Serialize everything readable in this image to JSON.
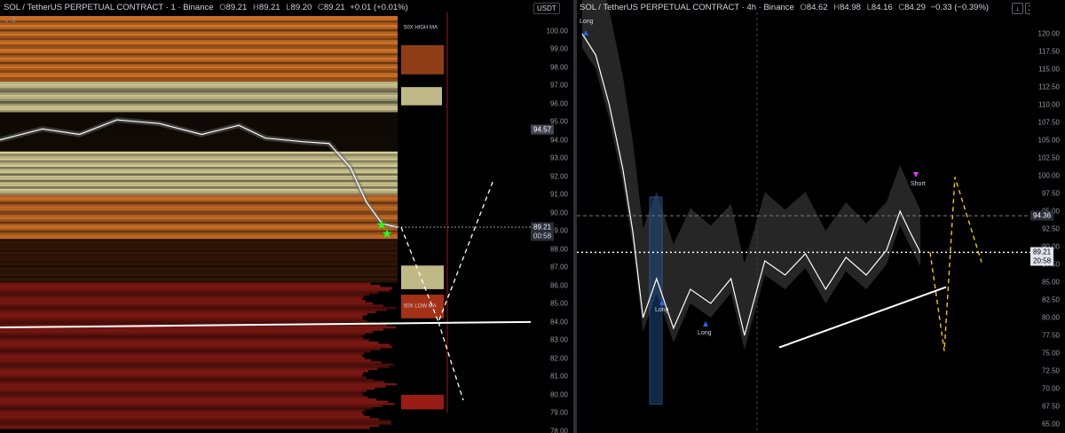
{
  "colors": {
    "background": "#000000",
    "heat_yellow": "#f0e6a8",
    "heat_orange": "#e07a2a",
    "heat_red": "#8a1a14",
    "ma_white": "#ffffff",
    "arrow_yellow": "#f5c518",
    "signal_blue": "#2962ff",
    "signal_pink": "#e040fb",
    "star_green": "#22ff22"
  },
  "left_chart": {
    "header": {
      "symbol": "SOL / TetherUS PERPETUAL CONTRACT · 1 · Binance",
      "o_label": "O",
      "o_value": "89.21",
      "h_label": "H",
      "h_value": "89.21",
      "l_label": "L",
      "l_value": "89.20",
      "c_label": "C",
      "c_value": "89.21",
      "change": "+0.01 (+0.01%)"
    },
    "indicator_count": "3",
    "currency": "USDT",
    "current_price": "89.21",
    "countdown": "00:58",
    "price_label_2": "94.57",
    "annotations": {
      "high_ma": "50X HIGH MA",
      "low_ma": "50X LOW MA"
    }
  },
  "right_chart": {
    "header": {
      "symbol": "SOL / TetherUS PERPETUAL CONTRACT · 4h · Binance",
      "o_label": "O",
      "o_value": "84.62",
      "h_label": "H",
      "h_value": "84.98",
      "l_label": "L",
      "l_value": "84.16",
      "c_label": "C",
      "c_value": "84.29",
      "change": "−0.33 (−0.39%)"
    },
    "current_price": "89.21",
    "countdown": "20:58",
    "alert_price": "94.36",
    "labels": {
      "long1": "Long",
      "long2": "Long",
      "long3": "Long",
      "short": "Short"
    }
  },
  "chart_data": [
    {
      "type": "heatmap",
      "title": "SOL / TetherUS PERPETUAL CONTRACT · 1 · Binance",
      "ylim": [
        78,
        101
      ],
      "y_ticks": [
        78,
        79,
        80,
        81,
        82,
        83,
        84,
        85,
        86,
        87,
        88,
        89,
        90,
        91,
        92,
        93,
        94,
        95,
        96,
        97,
        98,
        99,
        100
      ],
      "price_path": [
        {
          "t": 0,
          "y": 94.0
        },
        {
          "t": 0.08,
          "y": 94.6
        },
        {
          "t": 0.15,
          "y": 94.3
        },
        {
          "t": 0.22,
          "y": 95.1
        },
        {
          "t": 0.3,
          "y": 94.9
        },
        {
          "t": 0.38,
          "y": 94.3
        },
        {
          "t": 0.45,
          "y": 94.8
        },
        {
          "t": 0.5,
          "y": 94.1
        },
        {
          "t": 0.57,
          "y": 93.9
        },
        {
          "t": 0.62,
          "y": 93.8
        },
        {
          "t": 0.66,
          "y": 92.5
        },
        {
          "t": 0.69,
          "y": 90.6
        },
        {
          "t": 0.72,
          "y": 89.4
        },
        {
          "t": 0.75,
          "y": 89.2
        }
      ],
      "support_line": {
        "start": 83.7,
        "end": 84.0
      },
      "projection": [
        89.2,
        84.0,
        91.8,
        79.7
      ],
      "current_price": 89.21
    },
    {
      "type": "line",
      "title": "SOL / TetherUS PERPETUAL CONTRACT · 4h · Binance",
      "ylim": [
        64,
        123
      ],
      "y_ticks": [
        65,
        67.5,
        70,
        72.5,
        75,
        77.5,
        80,
        82.5,
        85,
        87.5,
        90,
        92.5,
        95,
        97.5,
        100,
        102.5,
        105,
        107.5,
        110,
        112.5,
        115,
        117.5,
        120
      ],
      "price_path": [
        {
          "t": 0,
          "y": 120.0
        },
        {
          "t": 0.04,
          "y": 117.0
        },
        {
          "t": 0.08,
          "y": 110.0
        },
        {
          "t": 0.12,
          "y": 101.0
        },
        {
          "t": 0.15,
          "y": 92.0
        },
        {
          "t": 0.18,
          "y": 80.0
        },
        {
          "t": 0.22,
          "y": 85.5
        },
        {
          "t": 0.27,
          "y": 78.5
        },
        {
          "t": 0.32,
          "y": 84.0
        },
        {
          "t": 0.38,
          "y": 82.0
        },
        {
          "t": 0.44,
          "y": 85.5
        },
        {
          "t": 0.48,
          "y": 77.5
        },
        {
          "t": 0.54,
          "y": 88.0
        },
        {
          "t": 0.6,
          "y": 86.0
        },
        {
          "t": 0.66,
          "y": 89.0
        },
        {
          "t": 0.72,
          "y": 84.0
        },
        {
          "t": 0.78,
          "y": 88.5
        },
        {
          "t": 0.84,
          "y": 86.0
        },
        {
          "t": 0.9,
          "y": 89.5
        },
        {
          "t": 0.94,
          "y": 95.0
        },
        {
          "t": 0.97,
          "y": 92.0
        },
        {
          "t": 1.0,
          "y": 89.2
        }
      ],
      "support_line": {
        "start": 75.8,
        "end": 84.3
      },
      "projection": [
        89.2,
        75.3,
        99.8,
        87.8
      ],
      "current_price": 89.21,
      "alert_price": 94.36
    }
  ]
}
